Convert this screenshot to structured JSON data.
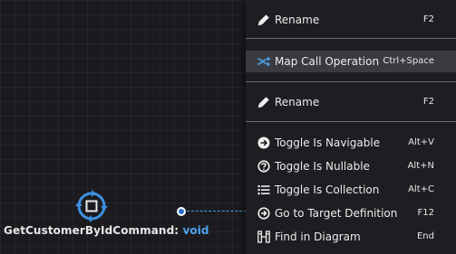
{
  "element": {
    "name": "GetCustomerByIdCommand:",
    "type": "void",
    "icon": "command-icon"
  },
  "context_menu": {
    "items": [
      {
        "label": "Rename",
        "shortcut": "F2",
        "icon": "pencil-icon"
      },
      {
        "label": "Map Call Operation",
        "shortcut": "Ctrl+Space",
        "icon": "map-icon",
        "highlighted": true
      },
      {
        "label": "Rename",
        "shortcut": "F2",
        "icon": "pencil-icon"
      },
      {
        "label": "Toggle Is Navigable",
        "shortcut": "Alt+V",
        "icon": "arrow-circle-icon"
      },
      {
        "label": "Toggle Is Nullable",
        "shortcut": "Alt+N",
        "icon": "question-circle-icon"
      },
      {
        "label": "Toggle Is Collection",
        "shortcut": "Alt+C",
        "icon": "list-icon"
      },
      {
        "label": "Go to Target Definition",
        "shortcut": "F12",
        "icon": "target-arrow-icon"
      },
      {
        "label": "Find in Diagram",
        "shortcut": "End",
        "icon": "find-in-diagram-icon"
      }
    ]
  },
  "colors": {
    "canvas": "#1b1b1f",
    "menu_background": "#1e1e22",
    "highlight": "#3a3b40",
    "accent_blue": "#4ea3f0"
  }
}
